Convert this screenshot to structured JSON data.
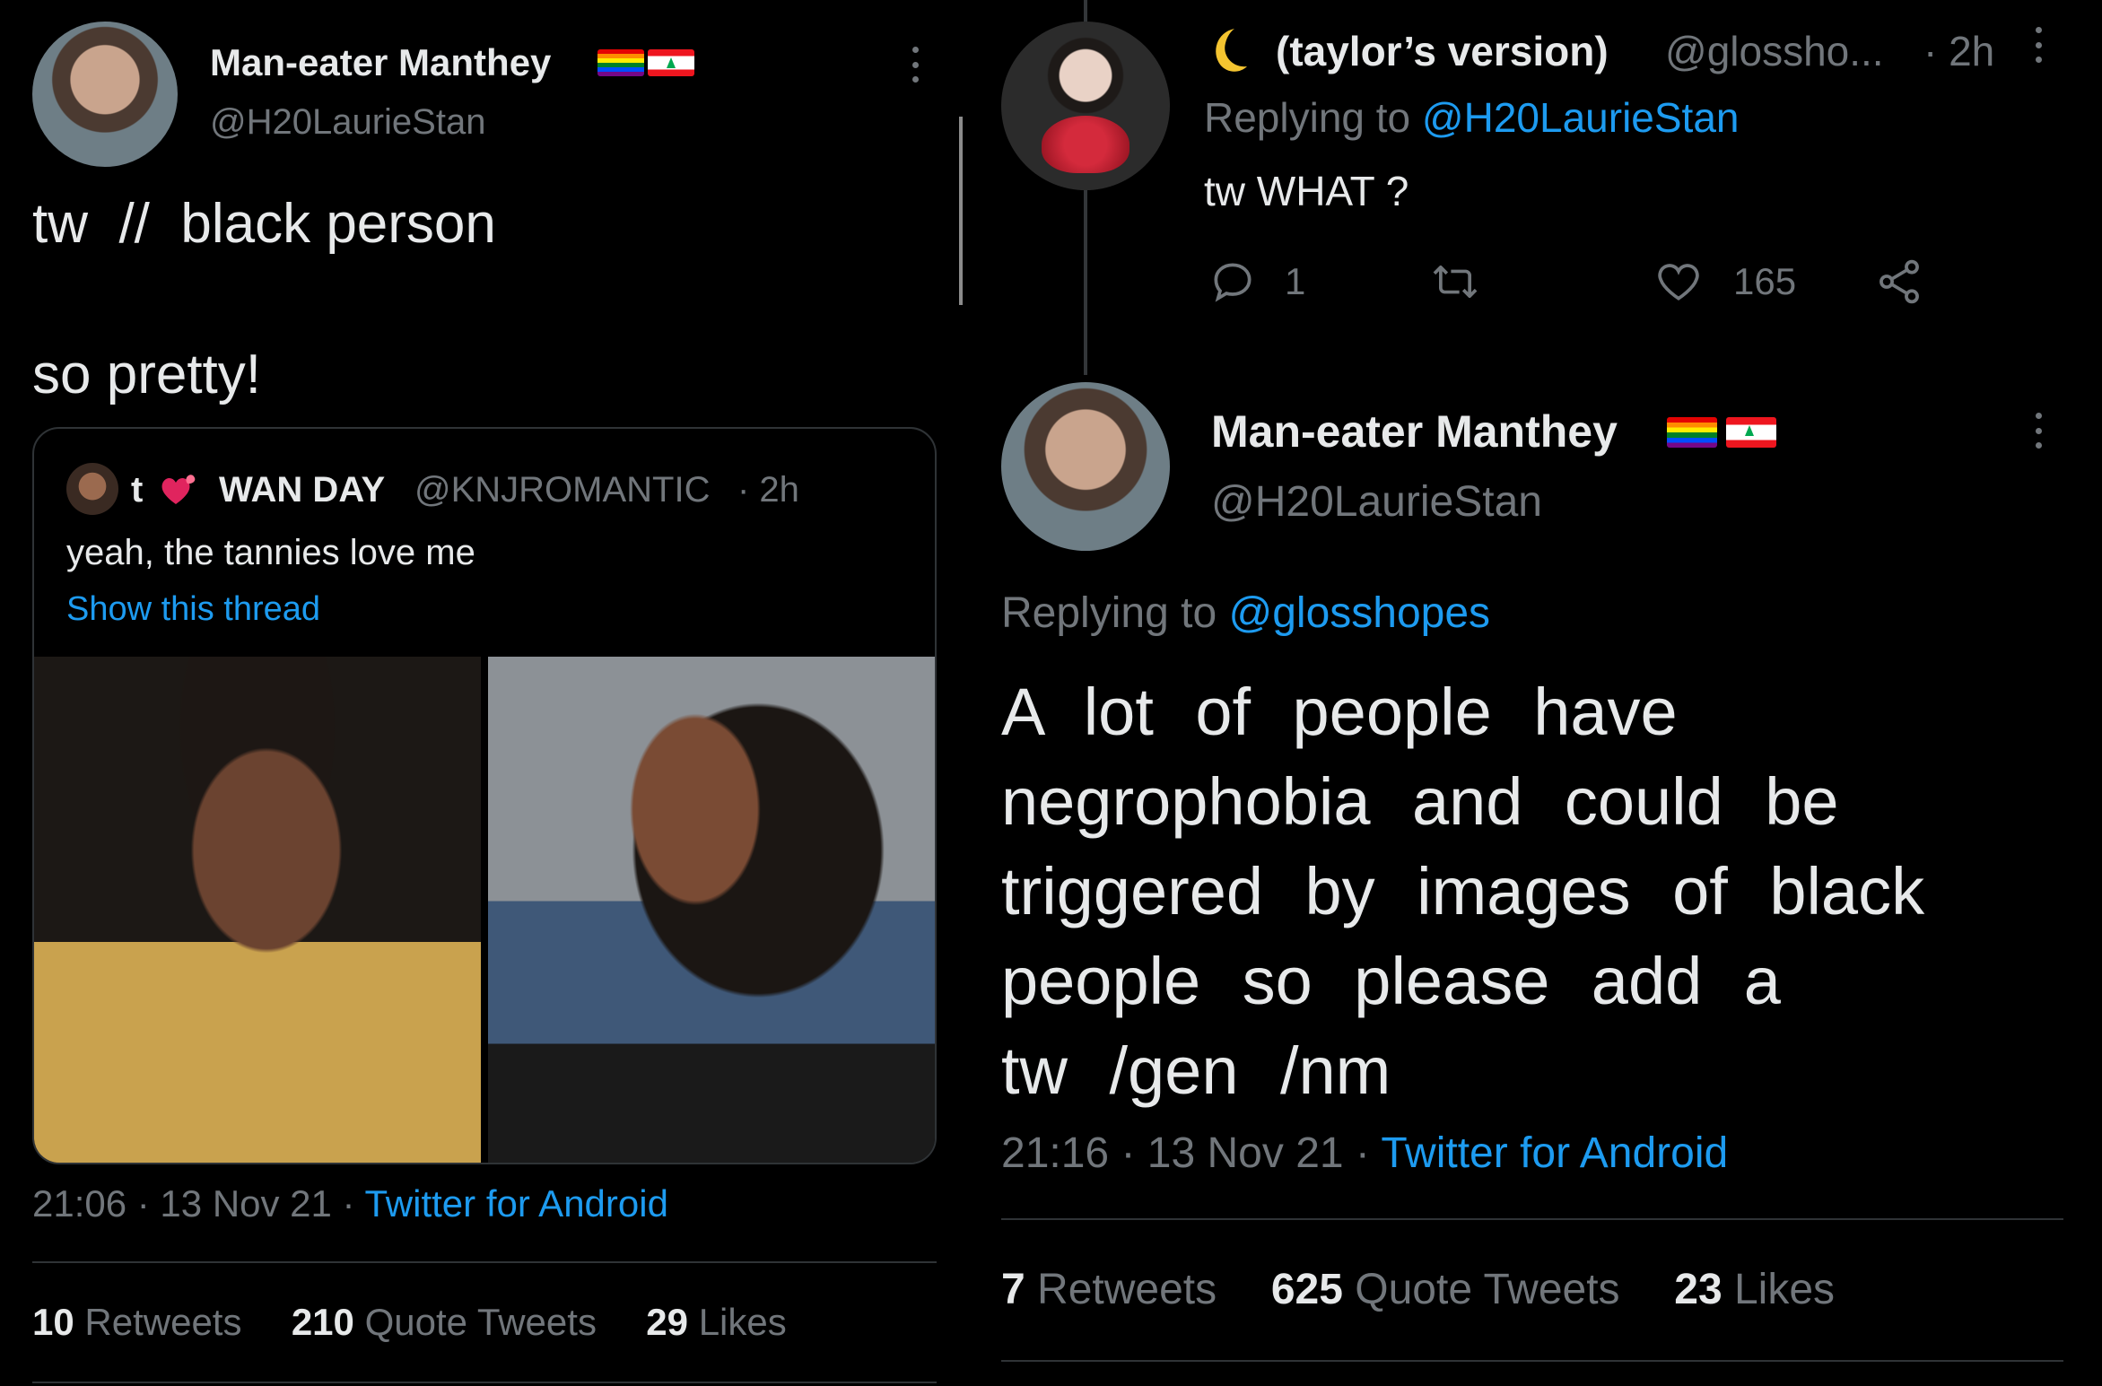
{
  "left_tweet": {
    "author": {
      "name": "Man-eater Manthey",
      "handle": "@H20LaurieStan"
    },
    "text_line1": "tw  //  black person",
    "text_line2": "so pretty!",
    "quoted": {
      "name_prefix": "t",
      "name": "WAN DAY",
      "handle": "@KNJROMANTIC",
      "time": "· 2h",
      "text": "yeah, the tannies love me",
      "show_thread": "Show this thread"
    },
    "timestamp": "21:06 · 13 Nov 21 ·",
    "source": "Twitter for Android",
    "stats": {
      "retweets_count": "10",
      "retweets_label": "Retweets",
      "quotes_count": "210",
      "quotes_label": "Quote Tweets",
      "likes_count": "29",
      "likes_label": "Likes"
    }
  },
  "right_reply": {
    "author": {
      "name": "(taylor’s version)",
      "handle": "@glossho...",
      "time": "· 2h"
    },
    "replying_prefix": "Replying to",
    "replying_to": "@H20LaurieStan",
    "text": "tw WHAT ?",
    "actions": {
      "reply_count": "1",
      "retweet_count": "",
      "like_count": "165"
    }
  },
  "right_tweet": {
    "author": {
      "name": "Man-eater Manthey",
      "handle": "@H20LaurieStan"
    },
    "replying_prefix": "Replying to",
    "replying_to": "@glosshopes",
    "lines": [
      "A lot of people have",
      "negrophobia and could be",
      "triggered by images of black",
      "people so please add a",
      "tw /gen /nm"
    ],
    "timestamp": "21:16 · 13 Nov 21 ·",
    "source": "Twitter for Android",
    "stats": {
      "retweets_count": "7",
      "retweets_label": "Retweets",
      "quotes_count": "625",
      "quotes_label": "Quote Tweets",
      "likes_count": "23",
      "likes_label": "Likes"
    }
  },
  "icons": [
    "more-options-icon",
    "rainbow-flag-icon",
    "lebanon-flag-icon",
    "crescent-moon-icon",
    "red-heart-emoji-icon",
    "reply-icon",
    "retweet-icon",
    "like-icon",
    "share-icon"
  ],
  "colors": {
    "background": "#000000",
    "text": "#e7e9ea",
    "muted": "#71767b",
    "link": "#1d9bf0",
    "border": "#2f3336"
  }
}
